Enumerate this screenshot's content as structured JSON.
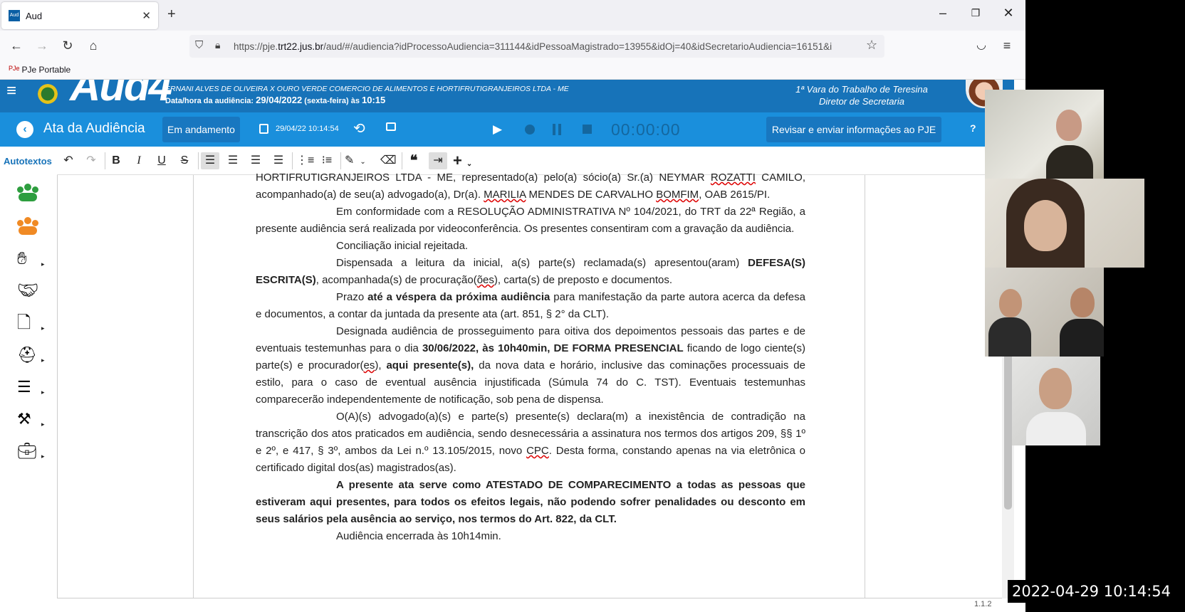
{
  "browser": {
    "tab_title": "Aud",
    "tab_favicon": "Aud",
    "url_prefix": "https://pje.",
    "url_domain": "trt22.jus.br",
    "url_rest": "/aud/#/audiencia?idProcessoAudiencia=311144&idPessoaMagistrado=13955&idOj=40&idSecretarioAudiencia=16151&i",
    "bookmark_icon": "PJe",
    "bookmark_label": "PJe Portable"
  },
  "app": {
    "logo_text": "Aud4",
    "case_parties": "ERNANI ALVES DE OLIVEIRA X OURO VERDE COMERCIO DE ALIMENTOS E HORTIFRUTIGRANJEIROS LTDA - ME",
    "date_label": "Data/hora da audiência:",
    "date_value": "29/04/2022",
    "date_weekday": "(sexta-feira) às",
    "date_time": "10:15",
    "org_unit": "1ª Vara do Trabalho de Teresina",
    "org_role": "Diretor de Secretaria"
  },
  "toolbar": {
    "title": "Ata da Audiência",
    "status": "Em andamento",
    "saved_time": "29/04/22 10:14:54",
    "timer": "00:00:00",
    "send_label": "Revisar e enviar informações ao PJE",
    "help": "?"
  },
  "sidebar": {
    "autotextos": "Autotextos"
  },
  "document": {
    "p1_a": "HORTIFRUTIGRANJEIROS LTDA - ME, representado(a) pelo(a) sócio(a) Sr.(a) NEYMAR ",
    "p1_sp1": "ROZATTI",
    "p1_b": " CAMILO, acompanhado(a) de seu(a) advogado(a), Dr(a). ",
    "p1_sp2": "MARILIA",
    "p1_c": " MENDES DE CARVALHO ",
    "p1_sp3": "BOMFIM",
    "p1_d": ", OAB 2615/PI.",
    "p2": "Em conformidade com a RESOLUÇÃO ADMINISTRATIVA Nº 104/2021, do TRT da 22ª Região, a presente audiência será realizada por videoconferência. Os presentes consentiram com a gravação da audiência.",
    "p3": "Conciliação inicial rejeitada.",
    "p4_a": "Dispensada a leitura da inicial, a(s) parte(s) reclamada(s) apresentou(aram) ",
    "p4_bold": "DEFESA(S) ESCRITA(S)",
    "p4_b": ", acompanhada(s) de procuração(",
    "p4_sp": "ões",
    "p4_c": "), carta(s) de preposto e documentos.",
    "p5_a": "Prazo ",
    "p5_bold": "até a véspera da próxima audiência",
    "p5_b": " para manifestação da parte autora acerca da defesa e documentos, a contar da juntada da presente ata (art. 851, § 2° da CLT).",
    "p6_a": "Designada audiência de prosseguimento para oitiva dos depoimentos pessoais das partes e de eventuais testemunhas para o dia ",
    "p6_bold": "30/06/2022, às 10h40min, DE FORMA PRESENCIAL",
    "p6_b": " ficando de logo ciente(s) parte(s) e procurador(",
    "p6_sp": "es",
    "p6_c": "), ",
    "p6_bold2": "aqui presente(s),",
    "p6_d": " da nova data e horário, inclusive das cominações processuais de estilo, para o caso de eventual ausência injustificada (Súmula 74 do C. TST). Eventuais testemunhas comparecerão independentemente de notificação, sob pena de dispensa.",
    "p7_a": "O(A)(s) advogado(a)(s) e parte(s) presente(s) declara(m) a inexistência de contradição na transcrição dos atos praticados em audiência, sendo desnecessária a assinatura nos termos dos artigos 209, §§ 1º e 2º, e 417, § 3º, ambos da Lei n.º 13.105/2015, novo ",
    "p7_sp": "CPC",
    "p7_b": ". Desta forma, constando apenas na via eletrônica o certificado digital dos(as) magistrados(as).",
    "p8": "A presente ata serve como ATESTADO DE COMPARECIMENTO a todas as pessoas que estiveram aqui presentes, para todos os efeitos legais, não podendo sofrer penalidades ou desconto em seus salários pela ausência ao serviço, nos termos do Art. 822, da CLT.",
    "p9": "Audiência encerrada às 10h14min."
  },
  "footer": {
    "version": "1.1.2",
    "clock": "2022-04-29 10:14:54"
  },
  "colors": {
    "header_blue": "#1773b9",
    "toolbar_blue": "#1a8fdc",
    "group_green": "#2e9e3f",
    "group_orange": "#f08a24"
  }
}
